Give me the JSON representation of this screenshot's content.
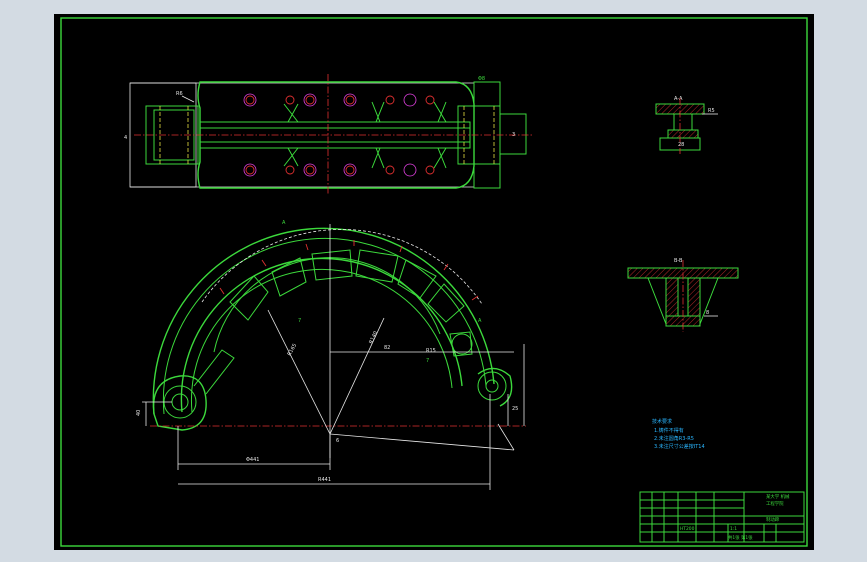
{
  "drawing": {
    "colors": {
      "background": "#000000",
      "outline": "#3cd93c",
      "centerline": "#e03030",
      "dimension": "#e8e8e8",
      "notes": "#29b6ff",
      "viewport_border": "#d3dbe3"
    },
    "section_labels": {
      "top_right": "A-A",
      "mid_right": "B-B"
    },
    "dimensions": {
      "bottom_overall": "R441",
      "bottom_inner": "Φ441"
    },
    "notes_block": {
      "heading": "技术要求",
      "lines": [
        "1.铸件不得有",
        "2.未注圆角R3-R5",
        "3.未注尺寸公差按IT14"
      ]
    },
    "title_block": {
      "part_name": "制动蹄",
      "school_line1": "某大学 机械",
      "school_line2": "工程学院",
      "material": "HT200",
      "scale": "1:1",
      "sheet": "共1张 第1张"
    }
  }
}
